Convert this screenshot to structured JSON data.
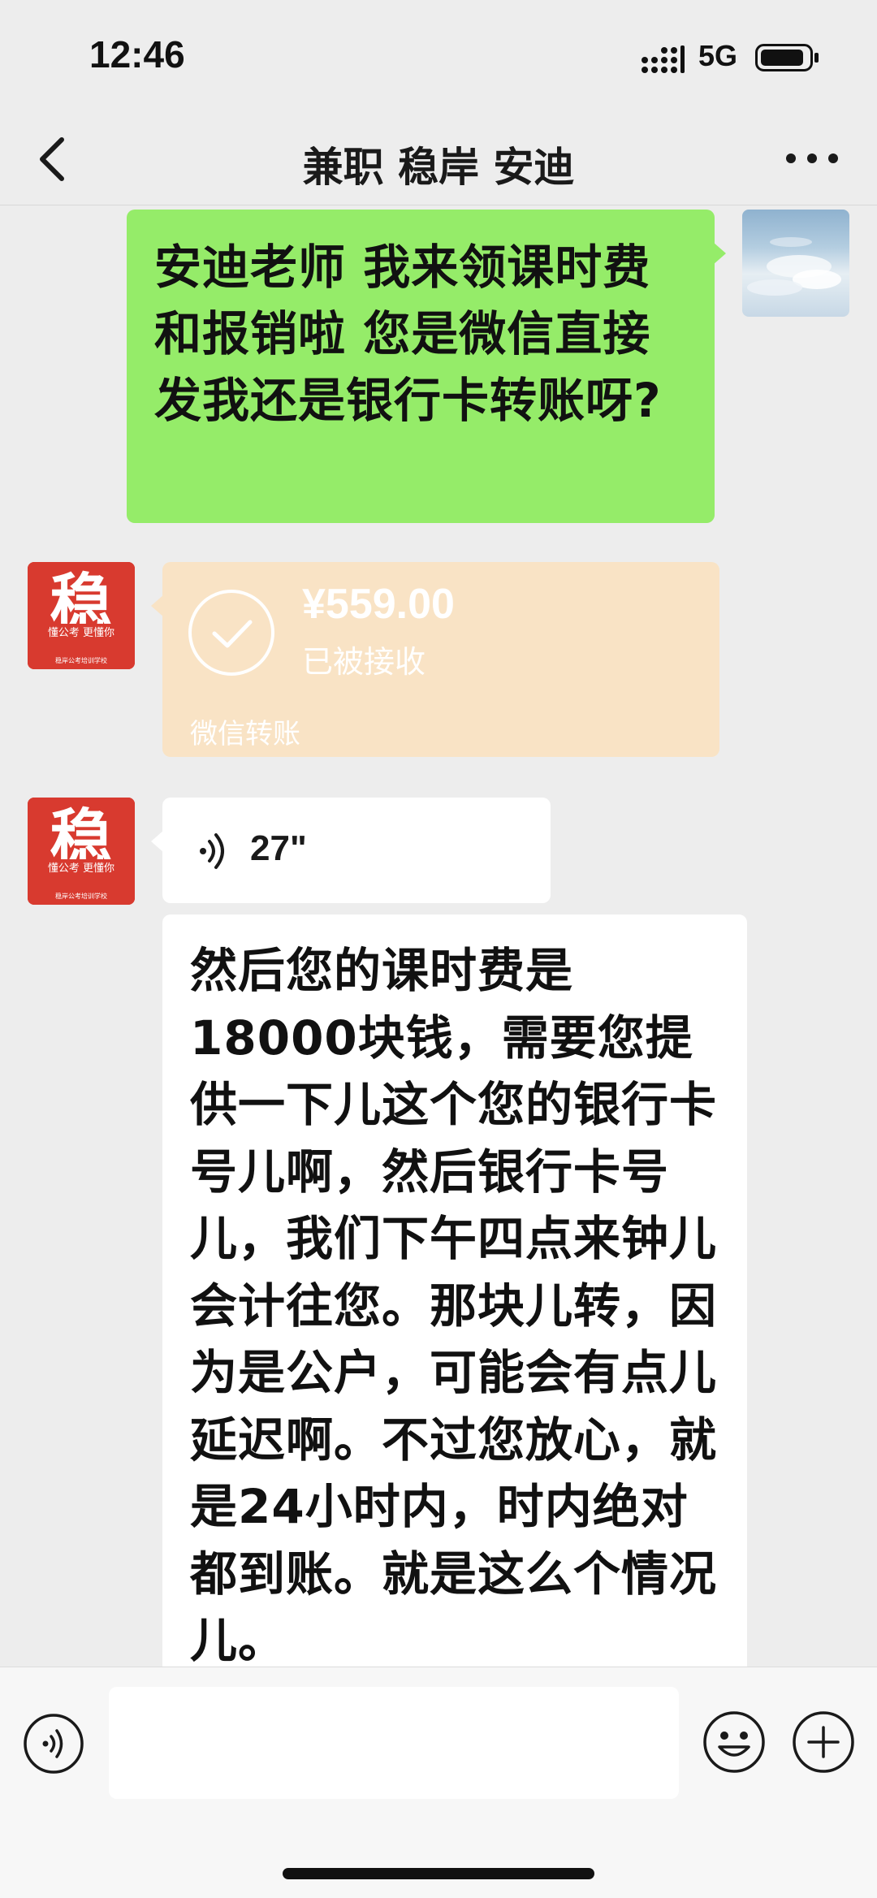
{
  "status_bar": {
    "time": "12:46",
    "network": "5G"
  },
  "nav": {
    "title": "兼职 稳岸 安迪"
  },
  "messages": {
    "outgoing_text": "安迪老师 我来领课时费和报销啦 您是微信直接发我还是银行卡转账呀?",
    "transfer": {
      "amount": "¥559.00",
      "status": "已被接收",
      "label": "微信转账"
    },
    "voice": {
      "duration": "27\""
    },
    "incoming_text": "然后您的课时费是18000块钱，需要您提供一下儿这个您的银行卡号儿啊，然后银行卡号儿，我们下午四点来钟儿会计往您。那块儿转，因为是公户，可能会有点儿延迟啊。不过您放心，就是24小时内，时内绝对都到账。就是这么个情况儿。"
  },
  "contact_avatar": {
    "char": "稳",
    "tagline": "懂公考 更懂你",
    "footer": "稳岸公考培训学校",
    "color": "#d83a2f"
  },
  "colors": {
    "outgoing_bubble": "#95ec69",
    "transfer_card": "#f9e3c5",
    "background": "#ededed"
  },
  "input": {
    "placeholder": ""
  }
}
